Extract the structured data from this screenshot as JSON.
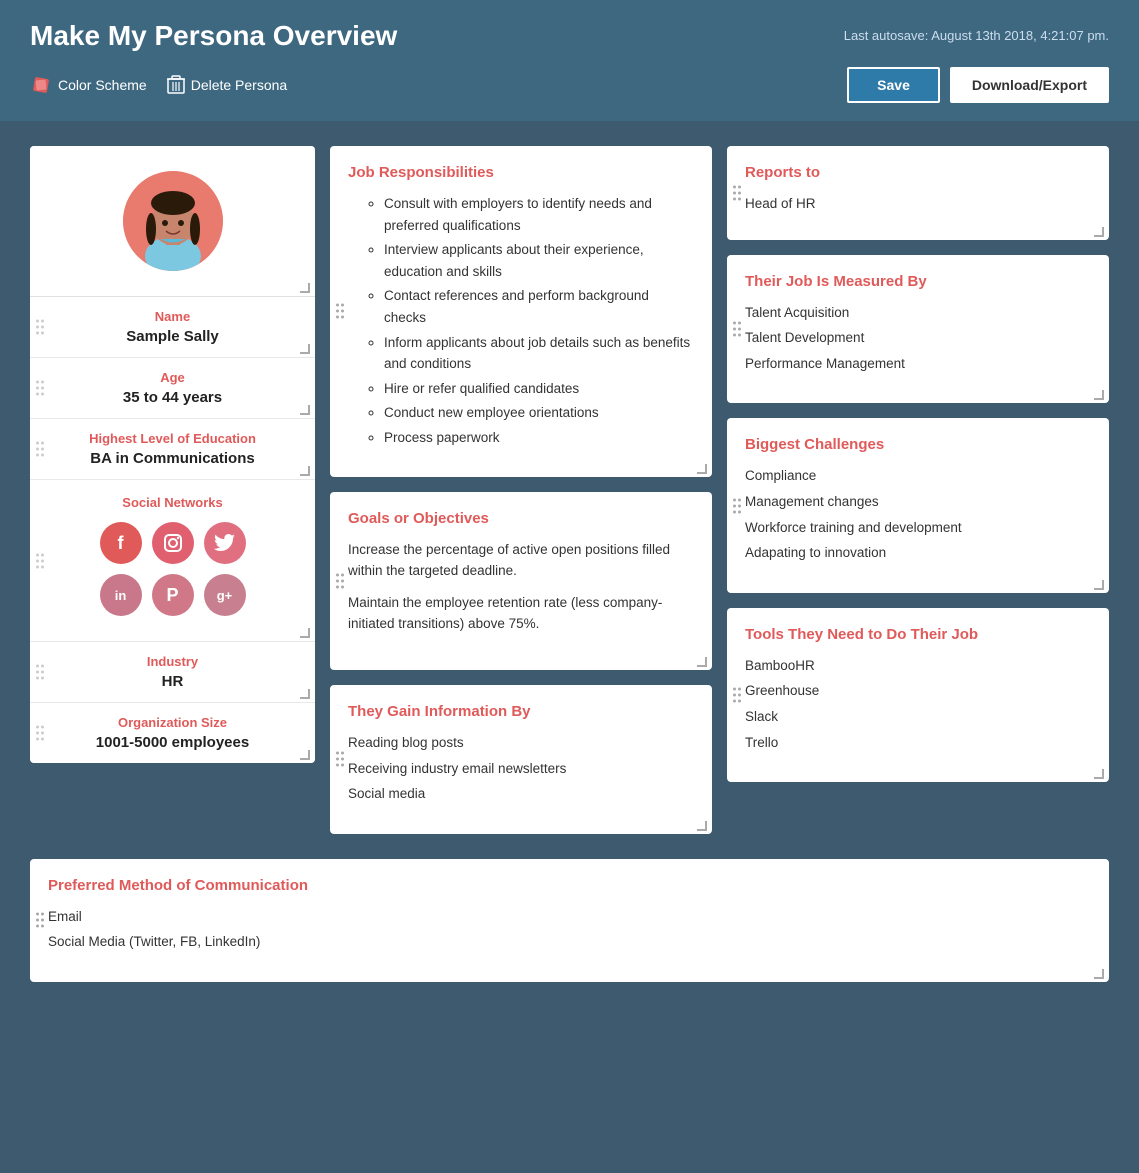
{
  "header": {
    "title": "Make My Persona Overview",
    "autosave": "Last autosave: August 13th 2018, 4:21:07 pm.",
    "color_scheme_label": "Color Scheme",
    "delete_persona_label": "Delete Persona",
    "save_label": "Save",
    "download_label": "Download/Export"
  },
  "left_panel": {
    "name_label": "Name",
    "name_value": "Sample Sally",
    "age_label": "Age",
    "age_value": "35 to 44 years",
    "education_label": "Highest Level of Education",
    "education_value": "BA in Communications",
    "social_label": "Social Networks",
    "industry_label": "Industry",
    "industry_value": "HR",
    "org_size_label": "Organization Size",
    "org_size_value": "1001-5000 employees"
  },
  "cards": {
    "job_responsibilities": {
      "title": "Job Responsibilities",
      "items": [
        "Consult with employers to identify needs and preferred qualifications",
        "Interview applicants about their experience, education and skills",
        "Contact references and perform background checks",
        "Inform applicants about job details such as benefits and conditions",
        "Hire or refer qualified candidates",
        "Conduct new employee orientations",
        "Process paperwork"
      ]
    },
    "reports_to": {
      "title": "Reports to",
      "value": "Head of HR"
    },
    "job_measured_by": {
      "title": "Their Job Is Measured By",
      "items": [
        "Talent Acquisition",
        "Talent Development",
        "Performance Management"
      ]
    },
    "goals": {
      "title": "Goals or Objectives",
      "paragraphs": [
        "Increase the percentage of active open positions filled within the targeted deadline.",
        "Maintain the employee retention rate (less company-initiated transitions) above 75%."
      ]
    },
    "biggest_challenges": {
      "title": "Biggest Challenges",
      "items": [
        "Compliance",
        "Management changes",
        "Workforce training and development",
        "Adapating to innovation"
      ]
    },
    "gain_information": {
      "title": "They Gain Information By",
      "items": [
        "Reading blog posts",
        "Receiving industry email newsletters",
        "Social media"
      ]
    },
    "tools": {
      "title": "Tools They Need to Do Their Job",
      "items": [
        "BambooHR",
        "Greenhouse",
        "Slack",
        "Trello"
      ]
    },
    "communication": {
      "title": "Preferred Method of Communication",
      "items": [
        "Email",
        "Social Media (Twitter, FB, LinkedIn)"
      ]
    }
  }
}
